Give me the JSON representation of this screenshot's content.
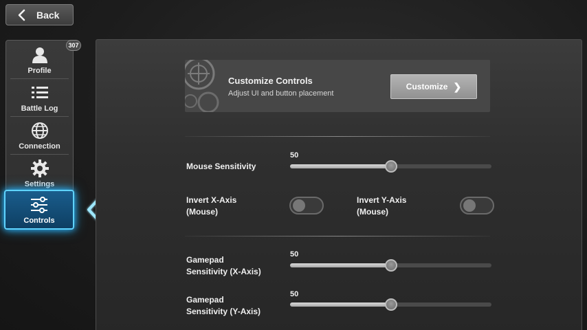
{
  "header": {
    "back_label": "Back"
  },
  "sidebar": {
    "badge_count": "307",
    "items": [
      {
        "label": "Profile",
        "icon": "person-icon"
      },
      {
        "label": "Battle Log",
        "icon": "list-icon"
      },
      {
        "label": "Connection",
        "icon": "globe-icon"
      },
      {
        "label": "Settings",
        "icon": "gear-icon"
      },
      {
        "label": "Controls",
        "icon": "sliders-icon",
        "active": true
      }
    ]
  },
  "customize_card": {
    "title": "Customize Controls",
    "subtitle": "Adjust UI and button placement",
    "button_label": "Customize"
  },
  "settings": {
    "mouse_sensitivity": {
      "label": "Mouse Sensitivity",
      "value": "50",
      "fraction": 0.5
    },
    "invert_x": {
      "label_line1": "Invert X-Axis",
      "label_line2": "(Mouse)",
      "on": false
    },
    "invert_y": {
      "label_line1": "Invert Y-Axis",
      "label_line2": "(Mouse)",
      "on": false
    },
    "gamepad_x": {
      "label_line1": "Gamepad",
      "label_line2": "Sensitivity (X-Axis)",
      "value": "50",
      "fraction": 0.5
    },
    "gamepad_y": {
      "label_line1": "Gamepad",
      "label_line2": "Sensitivity (Y-Axis)",
      "value": "50",
      "fraction": 0.5
    }
  },
  "colors": {
    "accent_glow": "#5fd4ff",
    "active_bg": "#1a5d8c"
  }
}
